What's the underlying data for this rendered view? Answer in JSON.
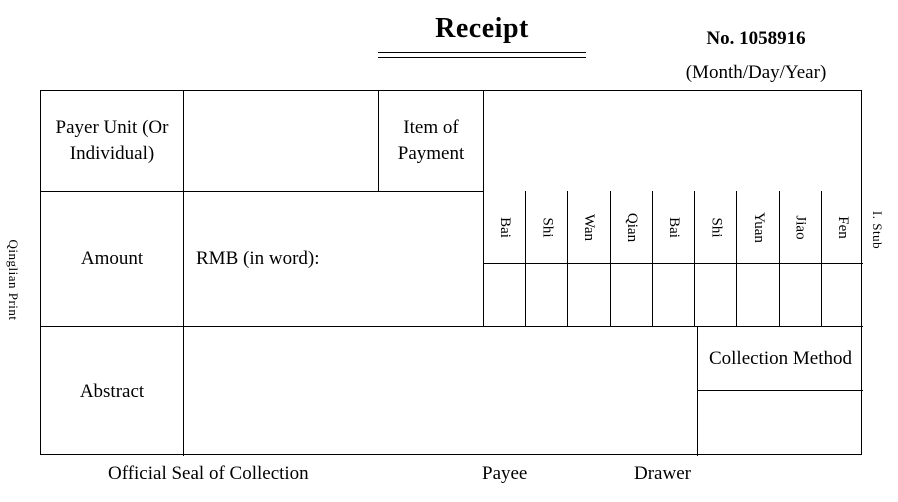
{
  "header": {
    "title": "Receipt",
    "number": "No. 1058916",
    "date_format": "(Month/Day/Year)"
  },
  "side_labels": {
    "left": "Qinglian Print",
    "right": "I. Stub"
  },
  "table": {
    "payer_label": "Payer Unit (Or Individual)",
    "payer_value": "",
    "item_label": "Item of Payment",
    "item_value": "",
    "amount_label": "Amount",
    "amount_words": "RMB (in word):",
    "abstract_label": "Abstract",
    "abstract_value": "",
    "collection_label": "Collection Method",
    "collection_value": "",
    "denominations": [
      {
        "label": "Bai",
        "value": ""
      },
      {
        "label": "Shi",
        "value": ""
      },
      {
        "label": "Wan",
        "value": ""
      },
      {
        "label": "Qian",
        "value": ""
      },
      {
        "label": "Bai",
        "value": ""
      },
      {
        "label": "Shi",
        "value": ""
      },
      {
        "label": "Yuan",
        "value": ""
      },
      {
        "label": "Jiao",
        "value": ""
      },
      {
        "label": "Fen",
        "value": ""
      }
    ]
  },
  "footer": {
    "seal": "Official Seal of Collection",
    "payee": "Payee",
    "drawer": "Drawer"
  },
  "colors": {
    "ink": "#000000",
    "paper": "#ffffff"
  }
}
